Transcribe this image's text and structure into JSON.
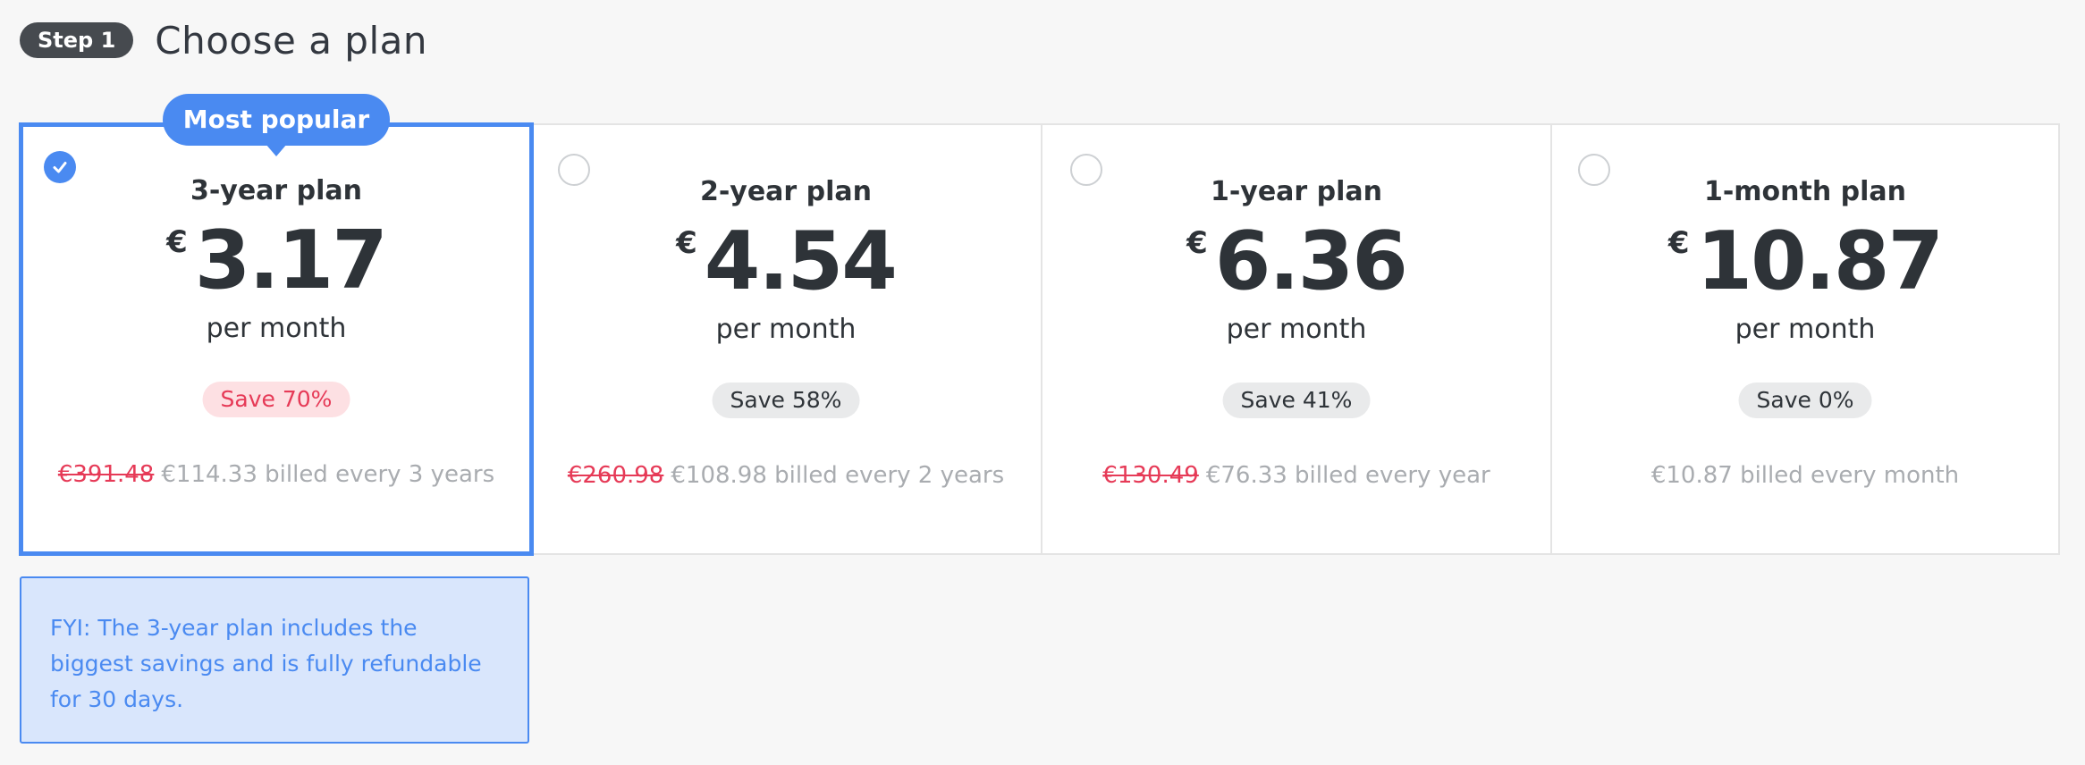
{
  "header": {
    "step_label": "Step 1",
    "title": "Choose a plan"
  },
  "colors": {
    "accent": "#4a8af1",
    "discount_red": "#e63a57",
    "text_dark": "#2e3338",
    "muted": "#a9acb0"
  },
  "plans": [
    {
      "name": "3-year plan",
      "currency": "€",
      "price": "3.17",
      "period": "per month",
      "save": "Save 70%",
      "old_price": "€391.48",
      "billing": "€114.33 billed every 3 years",
      "badge": "Most popular",
      "selected": true
    },
    {
      "name": "2-year plan",
      "currency": "€",
      "price": "4.54",
      "period": "per month",
      "save": "Save 58%",
      "old_price": "€260.98",
      "billing": "€108.98 billed every 2 years",
      "selected": false
    },
    {
      "name": "1-year plan",
      "currency": "€",
      "price": "6.36",
      "period": "per month",
      "save": "Save 41%",
      "old_price": "€130.49",
      "billing": "€76.33 billed every year",
      "selected": false
    },
    {
      "name": "1-month plan",
      "currency": "€",
      "price": "10.87",
      "period": "per month",
      "save": "Save 0%",
      "billing": "€10.87 billed every month",
      "selected": false
    }
  ],
  "fyi": {
    "text": "FYI: The 3-year plan includes the biggest savings and is fully refundable for 30 days."
  }
}
